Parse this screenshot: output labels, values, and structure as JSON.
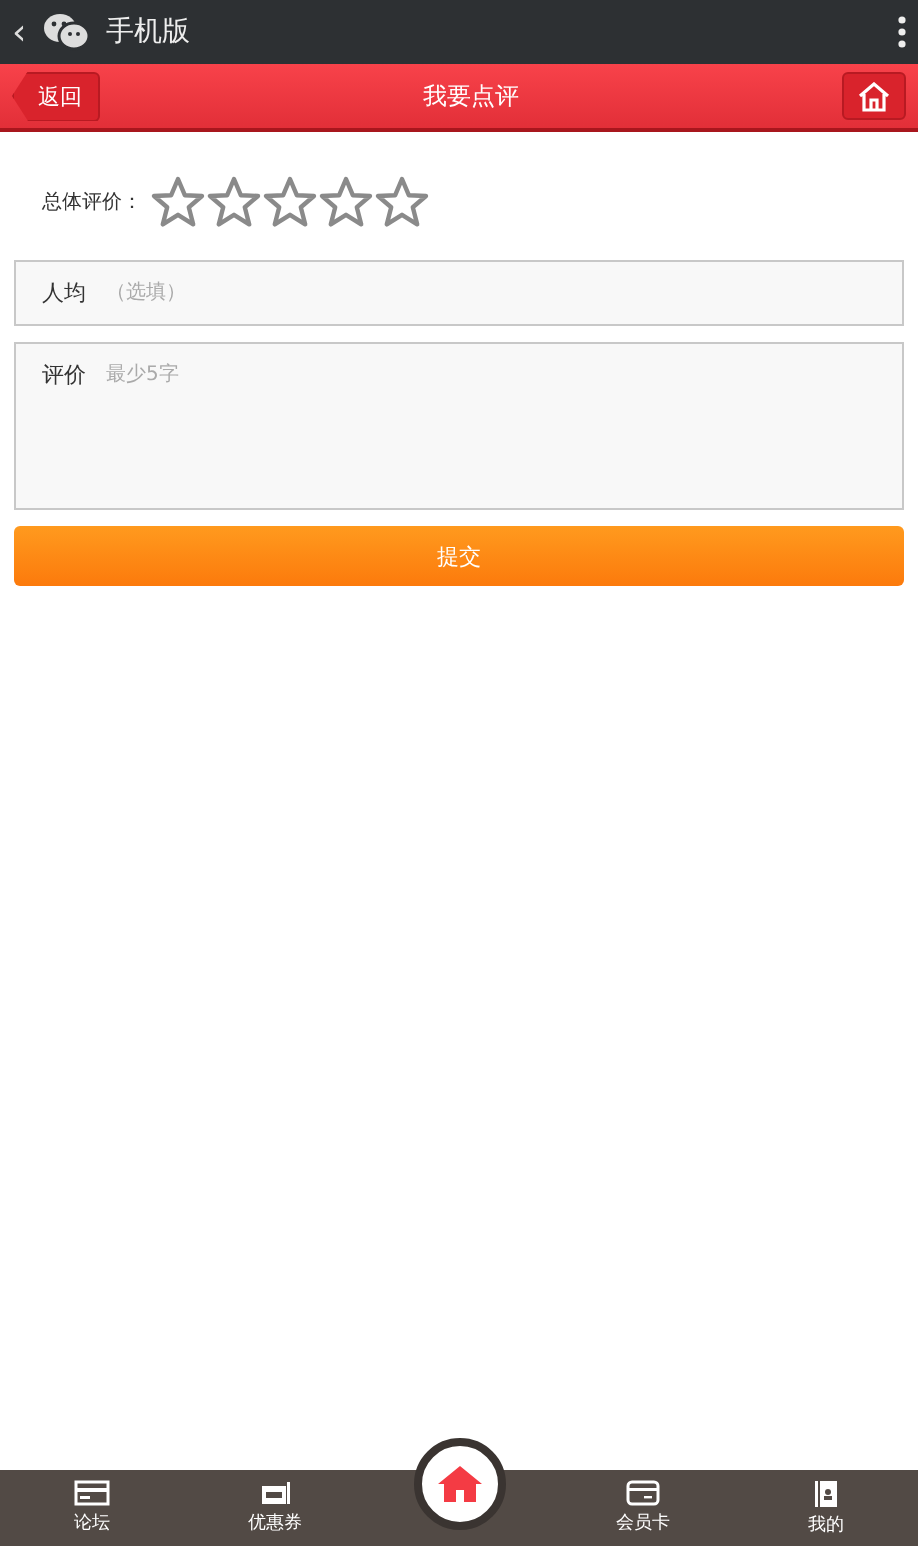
{
  "app_bar": {
    "back": "‹",
    "title": "手机版"
  },
  "header": {
    "back_button": "返回",
    "title": "我要点评"
  },
  "rating": {
    "label": "总体评价：",
    "stars": 0
  },
  "fields": [
    {
      "label": "人均",
      "placeholder": "（选填）",
      "kind": "input"
    },
    {
      "label": "评价",
      "placeholder": "最少5字",
      "kind": "textarea"
    }
  ],
  "submit": "提交",
  "tabs": [
    {
      "label": "论坛",
      "kind": "card"
    },
    {
      "label": "优惠券",
      "kind": "coupon"
    },
    {
      "kind": "home"
    },
    {
      "label": "会员卡",
      "kind": "member"
    },
    {
      "label": "我的",
      "kind": "profile"
    }
  ]
}
